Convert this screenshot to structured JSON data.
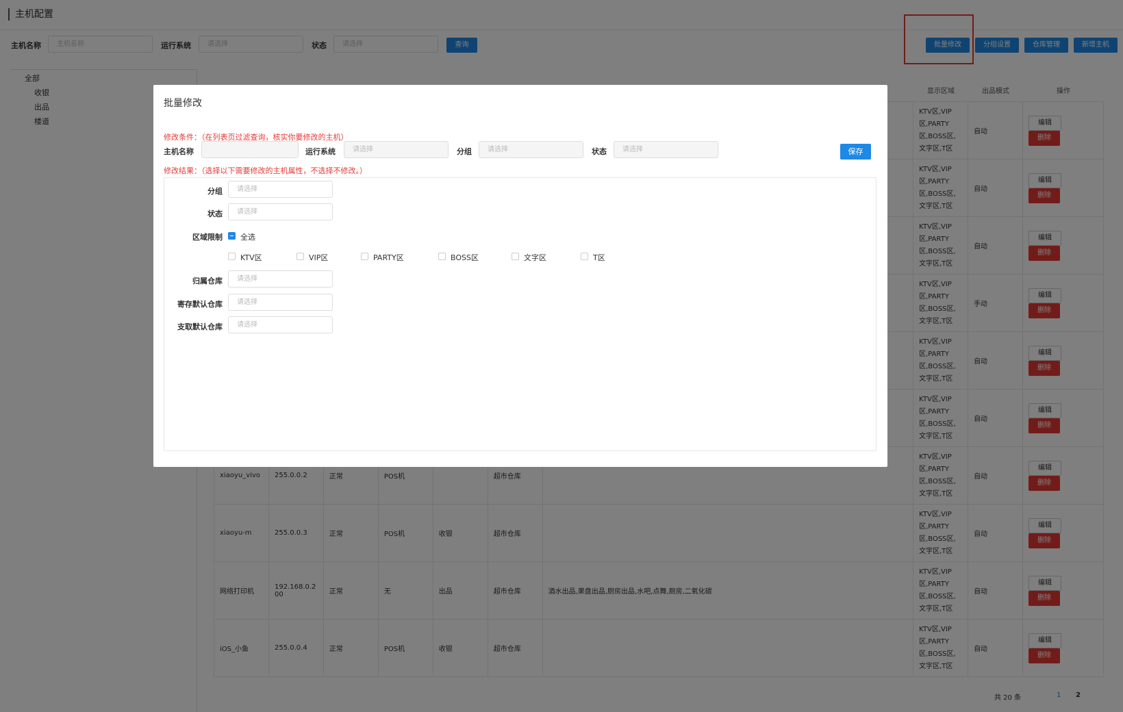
{
  "page": {
    "title": "主机配置"
  },
  "filter": {
    "host_name_label": "主机名称",
    "host_name_placeholder": "主机名称",
    "os_label": "运行系统",
    "os_placeholder": "请选择",
    "status_label": "状态",
    "status_placeholder": "请选择",
    "query_button": "查询"
  },
  "toolbar": {
    "batch_edit": "批量修改",
    "group_settings": "分组设置",
    "warehouse_manage": "仓库管理",
    "add_host": "新增主机"
  },
  "tree": {
    "items": [
      "全部",
      "收银",
      "出品",
      "楼道"
    ]
  },
  "table": {
    "headers": {
      "display_area": "显示区域",
      "output_mode": "出品模式",
      "actions": "操作"
    },
    "area_text": "KTV区,VIP区,PARTY区,BOSS区,文字区,T区",
    "edit_label": "编辑",
    "delete_label": "删除",
    "rows": [
      {
        "name": "",
        "ip": "",
        "status": "",
        "type": "",
        "group": "",
        "warehouse": "",
        "extra": "",
        "mode": "自动"
      },
      {
        "name": "",
        "ip": "",
        "status": "",
        "type": "",
        "group": "",
        "warehouse": "",
        "extra": "",
        "mode": "自动"
      },
      {
        "name": "",
        "ip": "",
        "status": "",
        "type": "",
        "group": "",
        "warehouse": "",
        "extra": "",
        "mode": "自动"
      },
      {
        "name": "",
        "ip": "",
        "status": "",
        "type": "",
        "group": "",
        "warehouse": "",
        "extra": "",
        "mode": "手动"
      },
      {
        "name": "",
        "ip": "",
        "status": "",
        "type": "",
        "group": "",
        "warehouse": "",
        "extra": "",
        "mode": "自动"
      },
      {
        "name": "",
        "ip": "",
        "status": "",
        "type": "",
        "group": "",
        "warehouse": "",
        "extra": "",
        "mode": "自动"
      },
      {
        "name": "xiaoyu_vivo",
        "ip": "255.0.0.2",
        "status": "正常",
        "type": "POS机",
        "group": "",
        "warehouse": "超市仓库",
        "extra": "",
        "mode": "自动"
      },
      {
        "name": "xiaoyu-m",
        "ip": "255.0.0.3",
        "status": "正常",
        "type": "POS机",
        "group": "收银",
        "warehouse": "超市仓库",
        "extra": "",
        "mode": "自动"
      },
      {
        "name": "网络打印机",
        "ip": "192.168.0.200",
        "status": "正常",
        "type": "无",
        "group": "出品",
        "warehouse": "超市仓库",
        "extra": "酒水出品,果盘出品,厨房出品,水吧,点舞,厨房,二氧化碳",
        "mode": "自动"
      },
      {
        "name": "iOS_小鱼",
        "ip": "255.0.0.4",
        "status": "正常",
        "type": "POS机",
        "group": "收银",
        "warehouse": "超市仓库",
        "extra": "",
        "mode": "自动"
      }
    ]
  },
  "pager": {
    "total": "共 20 条",
    "page1": "1",
    "page2": "2"
  },
  "modal": {
    "title": "批量修改",
    "condition_note": "修改条件：（在列表页过滤查询，核实你要修改的主机）",
    "host_name_label": "主机名称",
    "os_label": "运行系统",
    "os_placeholder": "请选择",
    "group_label": "分组",
    "group_placeholder": "请选择",
    "status_label": "状态",
    "status_placeholder": "请选择",
    "save_button": "保存",
    "result_note": "修改结果：（选择以下需要修改的主机属性，不选择不修改。）",
    "form": {
      "group_label": "分组",
      "group_placeholder": "请选择",
      "status_label": "状态",
      "status_placeholder": "请选择",
      "area_label": "区域限制",
      "select_all": "全选",
      "areas": [
        "KTV区",
        "VIP区",
        "PARTY区",
        "BOSS区",
        "文字区",
        "T区"
      ],
      "warehouse_label": "归属仓库",
      "warehouse_placeholder": "请选择",
      "deposit_label": "寄存默认仓库",
      "deposit_placeholder": "请选择",
      "withdraw_label": "支取默认仓库",
      "withdraw_placeholder": "请选择"
    }
  },
  "colors": {
    "primary": "#1e88e5",
    "danger": "#e53935"
  }
}
